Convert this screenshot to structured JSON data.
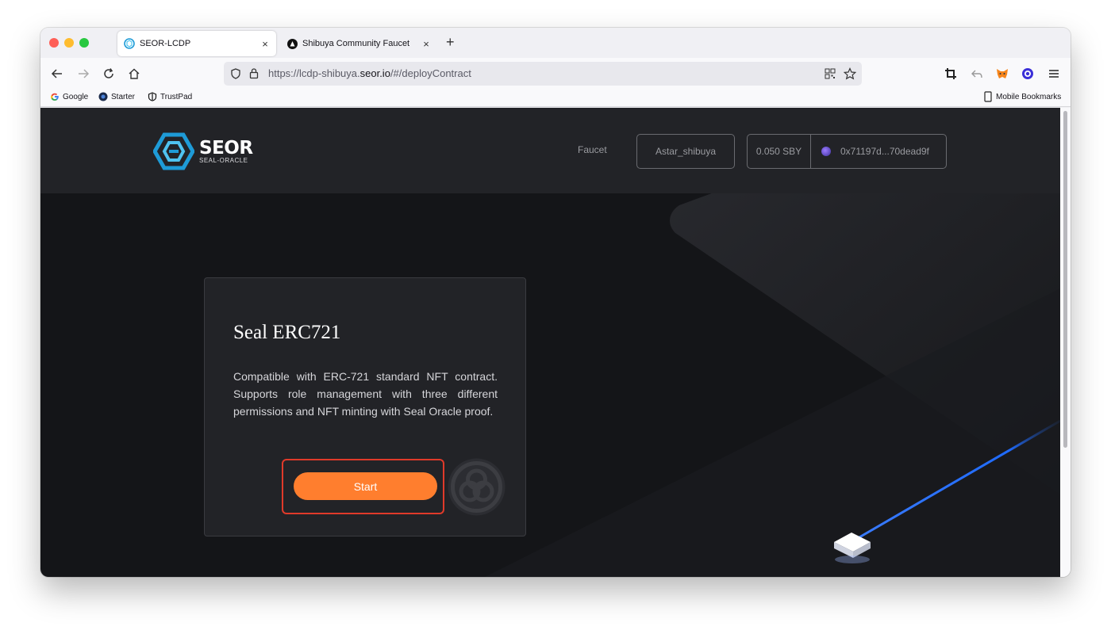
{
  "browser": {
    "tabs": [
      {
        "title": "SEOR-LCDP",
        "active": true,
        "icon": "seor-logo-icon"
      },
      {
        "title": "Shibuya Community Faucet",
        "active": false,
        "icon": "astar-logo-icon"
      }
    ],
    "close_glyph": "×",
    "new_tab_glyph": "+",
    "url": {
      "prefix": "https://lcdp-shibuya.",
      "domain": "seor.io",
      "suffix": "/#/deployContract"
    },
    "bookmarks": [
      {
        "label": "Google",
        "icon": "google-icon"
      },
      {
        "label": "Starter",
        "icon": "starter-icon"
      },
      {
        "label": "TrustPad",
        "icon": "trustpad-icon"
      }
    ],
    "mobile_bookmarks": "Mobile Bookmarks"
  },
  "header": {
    "logo_name": "SEOR",
    "logo_sub": "SEAL-ORACLE",
    "nav_faucet": "Faucet",
    "network": "Astar_shibuya",
    "balance": "0.050 SBY",
    "address": "0x71197d...70dead9f"
  },
  "card": {
    "title": "Seal ERC721",
    "description": "Compatible with ERC-721 standard NFT contract. Supports role management with three different permissions and NFT minting with Seal Oracle proof.",
    "button": "Start"
  },
  "colors": {
    "accent": "#ff7e2e",
    "brand_blue": "#1e9bd7",
    "highlight_red": "#e03a2a",
    "page_bg": "#141518"
  }
}
